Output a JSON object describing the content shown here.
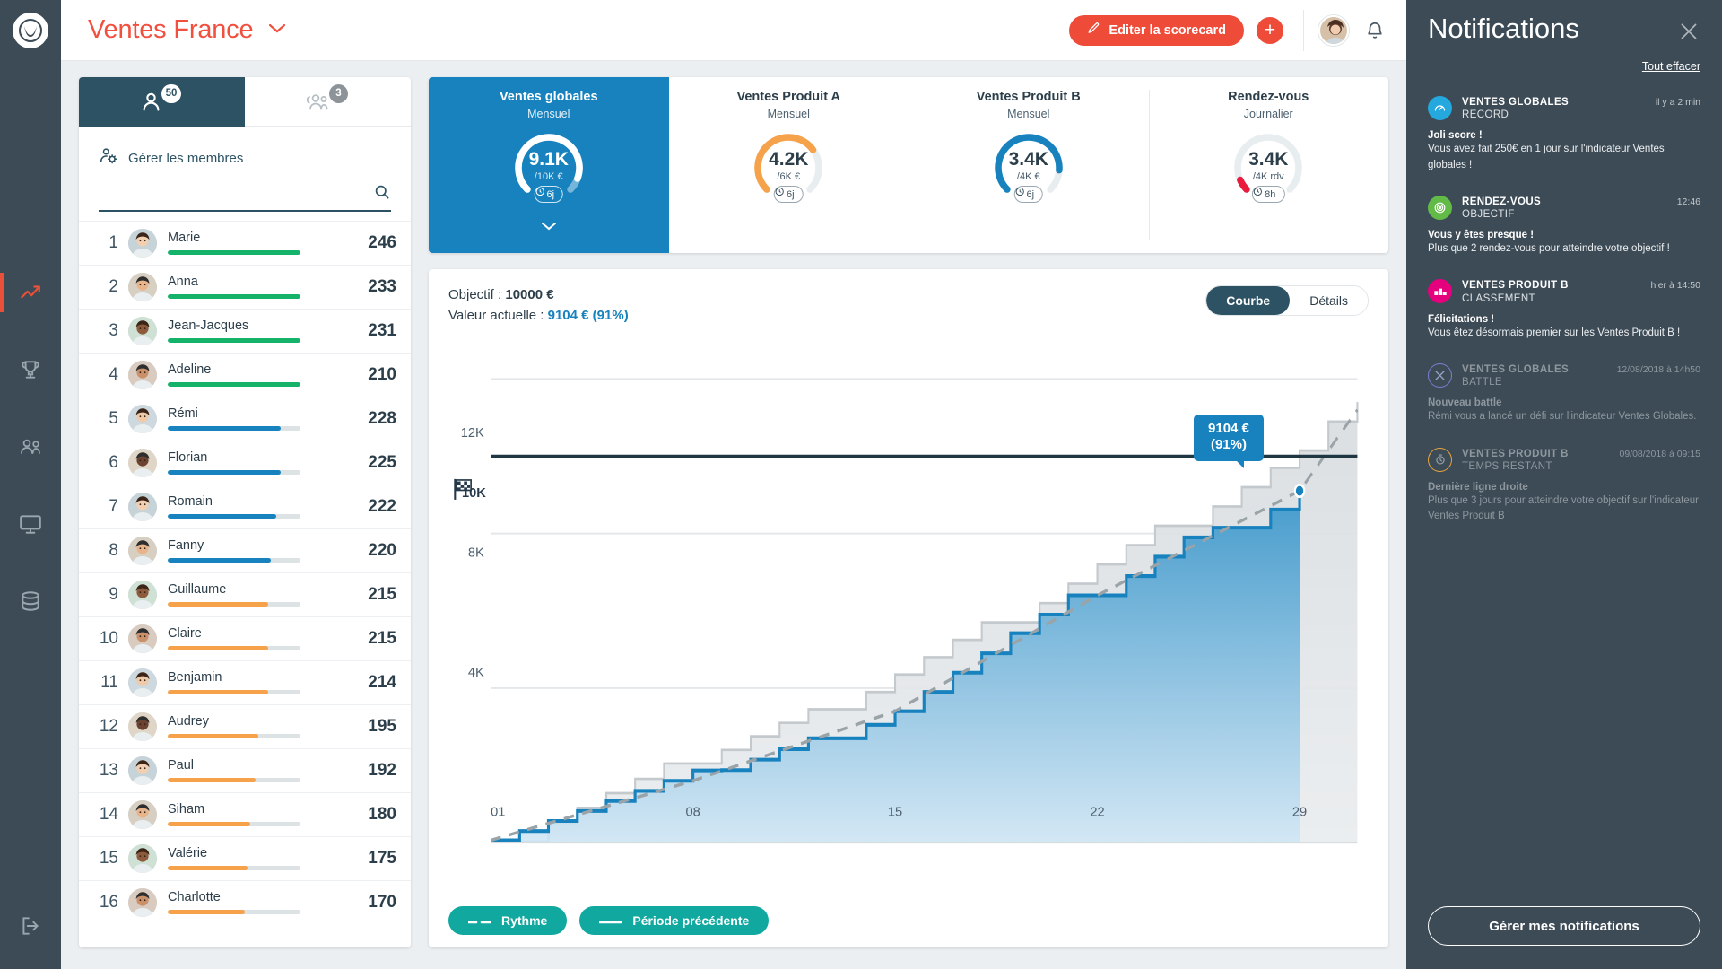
{
  "rail": {
    "logo_icon": "app-logo-icon",
    "items": [
      {
        "icon": "analytics-icon",
        "active": true
      },
      {
        "icon": "trophy-icon",
        "active": false
      },
      {
        "icon": "team-icon",
        "active": false
      },
      {
        "icon": "tv-screen-icon",
        "active": false
      },
      {
        "icon": "database-icon",
        "active": false
      }
    ],
    "logout_icon": "logout-icon"
  },
  "header": {
    "title": "Ventes France",
    "caret_icon": "chevron-down-icon",
    "edit_label": "Editer la scorecard",
    "edit_icon": "pencil-icon",
    "add_label": "+",
    "bell_icon": "bell-icon",
    "avatar_icon": "user-avatar"
  },
  "members_panel": {
    "tabs": [
      {
        "icon": "single-user-icon",
        "badge": "50",
        "active": true
      },
      {
        "icon": "group-users-icon",
        "badge": "3",
        "active": false
      }
    ],
    "manage_label": "Gérer les membres",
    "manage_icon": "manage-members-icon",
    "search_value": "",
    "search_placeholder": "",
    "search_icon": "search-icon",
    "rows": [
      {
        "rank": "1",
        "name": "Marie",
        "score": "246",
        "pct": 100,
        "color": "#15b36a"
      },
      {
        "rank": "2",
        "name": "Anna",
        "score": "233",
        "pct": 100,
        "color": "#15b36a"
      },
      {
        "rank": "3",
        "name": "Jean-Jacques",
        "score": "231",
        "pct": 100,
        "color": "#15b36a"
      },
      {
        "rank": "4",
        "name": "Adeline",
        "score": "210",
        "pct": 100,
        "color": "#15b36a"
      },
      {
        "rank": "5",
        "name": "Rémi",
        "score": "228",
        "pct": 85,
        "color": "#1782be"
      },
      {
        "rank": "6",
        "name": "Florian",
        "score": "225",
        "pct": 85,
        "color": "#1782be"
      },
      {
        "rank": "7",
        "name": "Romain",
        "score": "222",
        "pct": 82,
        "color": "#1782be"
      },
      {
        "rank": "8",
        "name": "Fanny",
        "score": "220",
        "pct": 78,
        "color": "#1782be"
      },
      {
        "rank": "9",
        "name": "Guillaume",
        "score": "215",
        "pct": 76,
        "color": "#f6a24a"
      },
      {
        "rank": "10",
        "name": "Claire",
        "score": "215",
        "pct": 76,
        "color": "#f6a24a"
      },
      {
        "rank": "11",
        "name": "Benjamin",
        "score": "214",
        "pct": 76,
        "color": "#f6a24a"
      },
      {
        "rank": "12",
        "name": "Audrey",
        "score": "195",
        "pct": 68,
        "color": "#f6a24a"
      },
      {
        "rank": "13",
        "name": "Paul",
        "score": "192",
        "pct": 66,
        "color": "#f6a24a"
      },
      {
        "rank": "14",
        "name": "Siham",
        "score": "180",
        "pct": 62,
        "color": "#f6a24a"
      },
      {
        "rank": "15",
        "name": "Valérie",
        "score": "175",
        "pct": 60,
        "color": "#f6a24a"
      },
      {
        "rank": "16",
        "name": "Charlotte",
        "score": "170",
        "pct": 58,
        "color": "#f6a24a"
      }
    ]
  },
  "kpis": [
    {
      "title": "Ventes globales",
      "period": "Mensuel",
      "value": "9.1K",
      "target": "/10K €",
      "time_label": "6j",
      "time_icon": "clock-icon",
      "pct": 91,
      "selected": true,
      "arc_color": "#ffffff",
      "track_color": "#76b6db",
      "caret_icon": "chevron-down-icon"
    },
    {
      "title": "Ventes Produit A",
      "period": "Mensuel",
      "value": "4.2K",
      "target": "/6K €",
      "time_label": "6j",
      "time_icon": "clock-icon",
      "pct": 70,
      "selected": false,
      "arc_color": "#f6a24a",
      "track_color": "#e8edf0"
    },
    {
      "title": "Ventes Produit B",
      "period": "Mensuel",
      "value": "3.4K",
      "target": "/4K €",
      "time_label": "6j",
      "time_icon": "clock-icon",
      "pct": 85,
      "selected": false,
      "arc_color": "#1782be",
      "track_color": "#e8edf0"
    },
    {
      "title": "Rendez-vous",
      "period": "Journalier",
      "value": "3.4K",
      "target": "/4K rdv",
      "time_label": "8h",
      "time_icon": "clock-icon",
      "pct": 8,
      "selected": false,
      "arc_color": "#ea1a3c",
      "track_color": "#e8edf0"
    }
  ],
  "chart_panel": {
    "objective_label": "Objectif : ",
    "objective_value": "10000 €",
    "current_label": "Valeur actuelle : ",
    "current_value": "9104 € (91%)",
    "toggle": {
      "curve": "Courbe",
      "details": "Détails",
      "active": "Courbe"
    },
    "tooltip_value": "9104 €",
    "tooltip_pct": "(91%)",
    "goal_flag_icon": "checkered-flag-icon",
    "legend": [
      {
        "label": "Rythme",
        "dash": true
      },
      {
        "label": "Période précédente",
        "dash": false
      }
    ]
  },
  "chart_data": {
    "type": "area",
    "title": "Ventes globales — progression mensuelle",
    "xlabel": "",
    "ylabel": "",
    "ylim": [
      0,
      12800
    ],
    "yticks": [
      4000,
      8000,
      10000,
      12000
    ],
    "ytick_labels": [
      "4K",
      "8K",
      "10K",
      "12K"
    ],
    "xticks": [
      1,
      8,
      15,
      22,
      29
    ],
    "xtick_labels": [
      "01",
      "08",
      "15",
      "22",
      "29"
    ],
    "goal": 10000,
    "goal_label": "10K",
    "grid": true,
    "legend_position": "bottom-left",
    "series": [
      {
        "name": "Valeur actuelle",
        "type": "area",
        "color": "#1782be",
        "x": [
          1,
          2,
          3,
          4,
          5,
          6,
          7,
          8,
          9,
          10,
          11,
          12,
          13,
          14,
          15,
          16,
          17,
          18,
          19,
          20,
          21,
          22,
          23,
          24,
          25,
          26,
          27,
          28,
          29
        ],
        "values": [
          60,
          300,
          560,
          820,
          1080,
          1340,
          1600,
          1870,
          1880,
          2150,
          2420,
          2700,
          2700,
          3050,
          3400,
          3900,
          4400,
          4900,
          5420,
          5900,
          6400,
          6400,
          6900,
          7400,
          7900,
          8150,
          8150,
          8620,
          9104
        ]
      },
      {
        "name": "Période précédente",
        "type": "line",
        "color": "#b9c0c4",
        "x": [
          1,
          2,
          3,
          4,
          5,
          6,
          7,
          8,
          9,
          10,
          11,
          12,
          13,
          14,
          15,
          16,
          17,
          18,
          19,
          20,
          21,
          22,
          23,
          24,
          25,
          26,
          27,
          28,
          29,
          30,
          31
        ],
        "values": [
          30,
          30,
          520,
          900,
          1280,
          1650,
          2050,
          2050,
          2400,
          2750,
          3100,
          3450,
          3450,
          3900,
          4350,
          4800,
          5250,
          5700,
          5700,
          6200,
          6700,
          7200,
          7700,
          8200,
          8200,
          8700,
          9200,
          9700,
          10150,
          10900,
          11400
        ]
      },
      {
        "name": "Rythme",
        "type": "dashed-line",
        "color": "#9aa3a8",
        "x": [
          1,
          8,
          15,
          22,
          29,
          31
        ],
        "values": [
          60,
          1600,
          3400,
          6400,
          9104,
          11200
        ]
      }
    ]
  },
  "notifications": {
    "title": "Notifications",
    "close_icon": "close-icon",
    "clear_all": "Tout effacer",
    "manage_button": "Gérer mes notifications",
    "items": [
      {
        "indicator": "VENTES GLOBALES",
        "kind": "RECORD",
        "time": "il y a 2 min",
        "headline": "Joli score !",
        "body": "Vous avez fait 250€ en 1 jour sur l'indicateur Ventes globales !",
        "icon": "speedometer-icon",
        "icon_bg": "#24a8dd",
        "read": false
      },
      {
        "indicator": "RENDEZ-VOUS",
        "kind": "OBJECTIF",
        "time": "12:46",
        "headline": "Vous y êtes presque !",
        "body": "Plus que 2 rendez-vous pour atteindre votre objectif !",
        "icon": "target-icon",
        "icon_bg": "#62bb46",
        "read": false
      },
      {
        "indicator": "VENTES PRODUIT B",
        "kind": "CLASSEMENT",
        "time": "hier à 14:50",
        "headline": "Félicitations !",
        "body": "Vous êtez désormais premier sur les Ventes Produit B !",
        "icon": "podium-icon",
        "icon_bg": "#e5007e",
        "read": false
      },
      {
        "indicator": "VENTES GLOBALES",
        "kind": "BATTLE",
        "time": "12/08/2018 à 14h50",
        "headline": "Nouveau battle",
        "body": "Rémi vous a lancé un défi sur l'indicateur Ventes Globales.",
        "icon": "battle-swords-icon",
        "icon_bg": "transparent",
        "icon_border": "#7b7fd4",
        "read": true
      },
      {
        "indicator": "VENTES PRODUIT B",
        "kind": "TEMPS RESTANT",
        "time": "09/08/2018 à 09:15",
        "headline": "Dernière ligne droite",
        "body": "Plus que 3 jours pour atteindre votre objectif sur l'indicateur Ventes Produit B !",
        "icon": "stopwatch-icon",
        "icon_bg": "transparent",
        "icon_border": "#e8a33d",
        "read": true
      }
    ]
  }
}
